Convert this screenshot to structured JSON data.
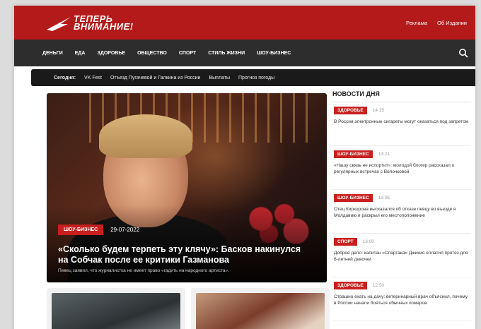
{
  "header": {
    "logo_line1": "ТЕПЕРЬ",
    "logo_line2": "ВНИМАНИЕ!",
    "links": [
      "Реклама",
      "Об Издании"
    ],
    "brand_color": "#b51a1a"
  },
  "nav": {
    "items": [
      "ДЕНЬГИ",
      "ЕДА",
      "ЗДОРОВЬЕ",
      "ОБЩЕСТВО",
      "СПОРТ",
      "СТИЛЬ ЖИЗНИ",
      "ШОУ-БИЗНЕС"
    ],
    "search_icon": "search-icon"
  },
  "today": {
    "label": "Сегодня:",
    "items": [
      "VK Fest",
      "Отъезд Пугачевой и Галкина из России",
      "Выплаты",
      "Прогноз погоды"
    ]
  },
  "hero": {
    "badge": "ШОУ-БИЗНЕС",
    "date": "29-07-2022",
    "title": "«Сколько будем терпеть эту клячу»: Басков накинулся на Собчак после ее критики Газманова",
    "subtitle": "Певец заявил, что журналистка не имеет право «гадить на народного артиста»."
  },
  "news": {
    "title": "НОВОСТИ ДНЯ",
    "items": [
      {
        "badge": "ЗДОРОВЬЕ",
        "time": "14:15",
        "text": "В России электронные сигареты могут оказаться под запретом"
      },
      {
        "badge": "ШОУ-БИЗНЕС",
        "time": "13:21",
        "text": "«Нашу связь не испортит»: молодой блогер рассказал о регулярных встречах с Волочковой"
      },
      {
        "badge": "ШОУ-БИЗНЕС",
        "time": "13:05",
        "text": "Отец Киркорова высказался об отказе певцу во въезде в Молдавию и раскрыл его местоположение"
      },
      {
        "badge": "СПОРТ",
        "time": "13:00",
        "text": "Доброе дело: капитан «Спартака» Джикия оплатил протез для 6-летней девочки"
      },
      {
        "badge": "ЗДОРОВЬЕ",
        "time": "12:50",
        "text": "Страшно ехать на дачу: ветеринарный врач объяснил, почему в России начали бояться обычных комаров"
      }
    ]
  }
}
